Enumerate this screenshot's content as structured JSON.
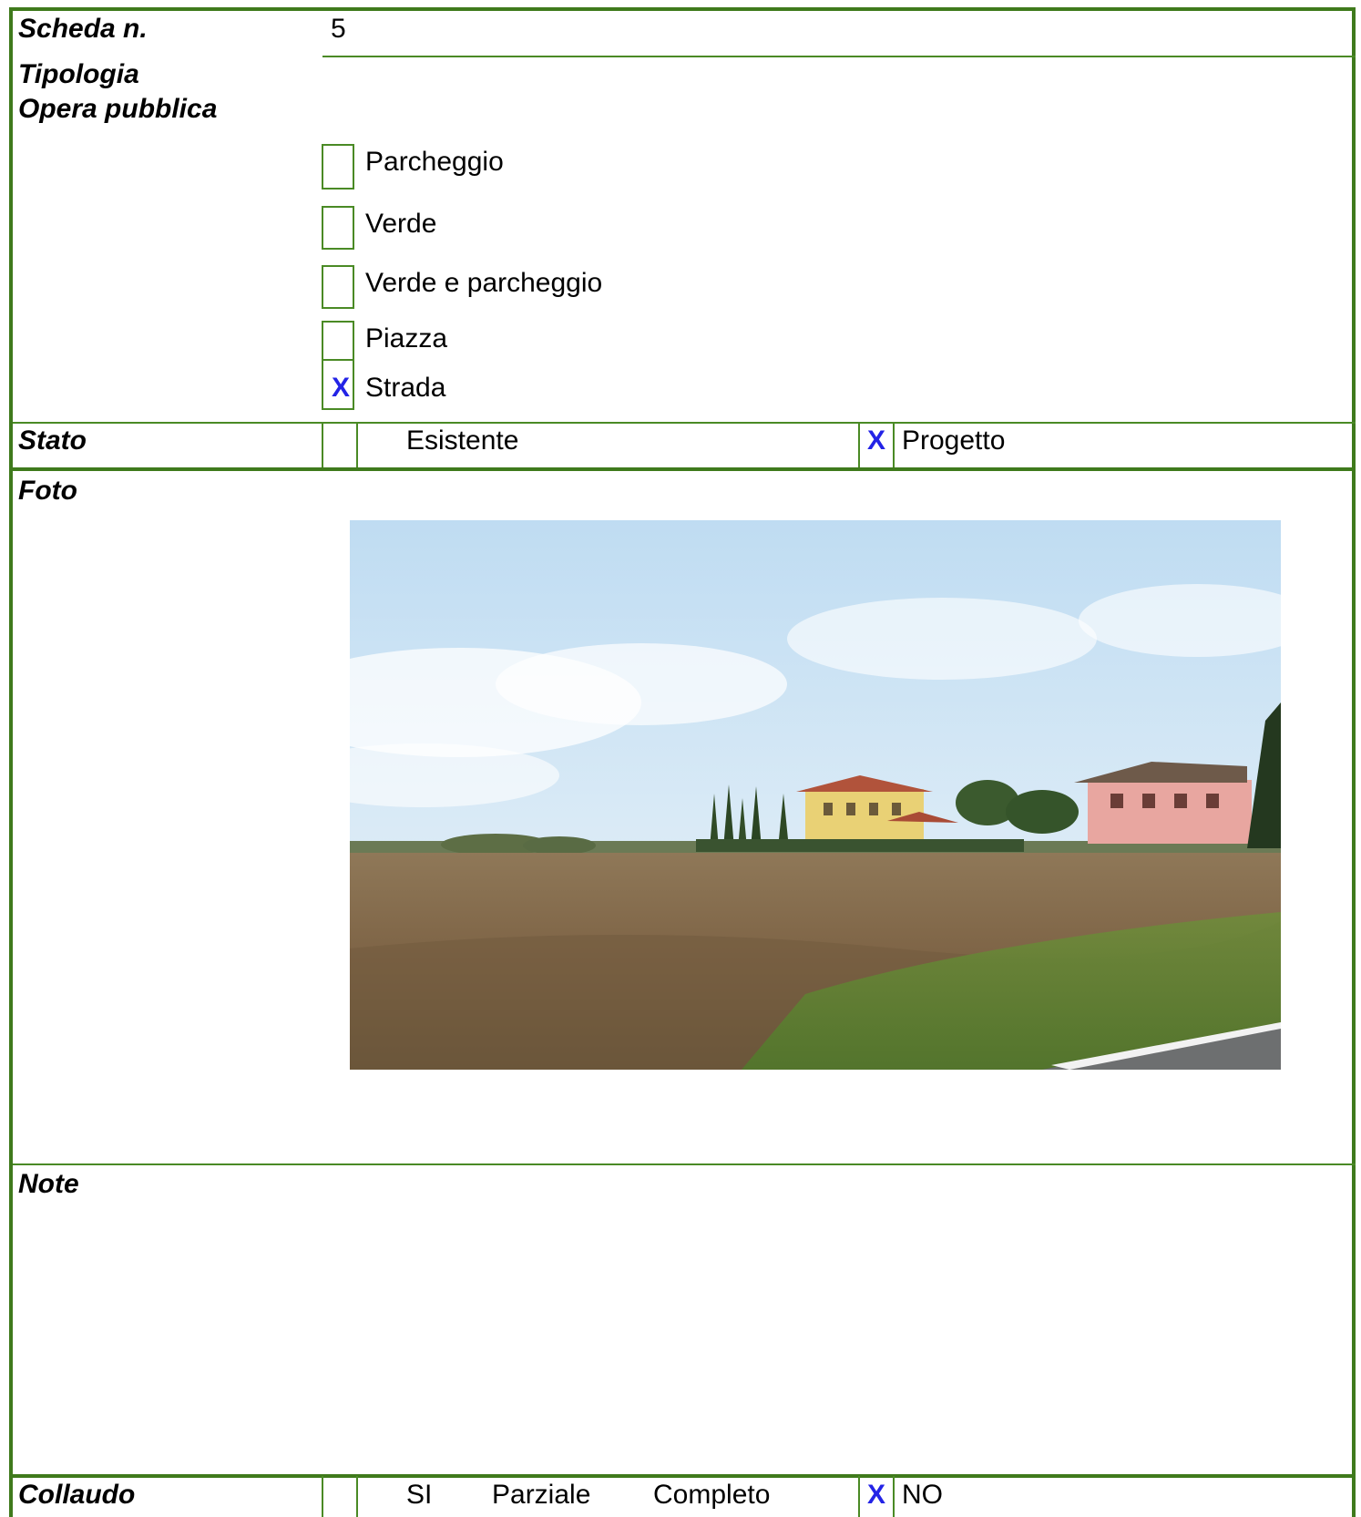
{
  "header": {
    "label": "Scheda n.",
    "value": "5"
  },
  "tipologia": {
    "label_line1": "Tipologia",
    "label_line2": "Opera pubblica",
    "options": [
      {
        "label": "Parcheggio",
        "checked": false
      },
      {
        "label": "Verde",
        "checked": false
      },
      {
        "label": "Verde e parcheggio",
        "checked": false
      },
      {
        "label": "Piazza",
        "checked": false
      },
      {
        "label": "Strada",
        "checked": true
      }
    ],
    "check_mark": "X"
  },
  "stato": {
    "label": "Stato",
    "option_existing": "Esistente",
    "option_project": "Progetto",
    "project_mark": "X"
  },
  "foto": {
    "label": "Foto"
  },
  "note": {
    "label": "Note"
  },
  "collaudo": {
    "label": "Collaudo",
    "options": [
      "SI",
      "Parziale",
      "Completo"
    ],
    "no_mark": "X",
    "no_label": "NO"
  },
  "colors": {
    "border": "#4a8a25",
    "mark": "#2323e6"
  }
}
